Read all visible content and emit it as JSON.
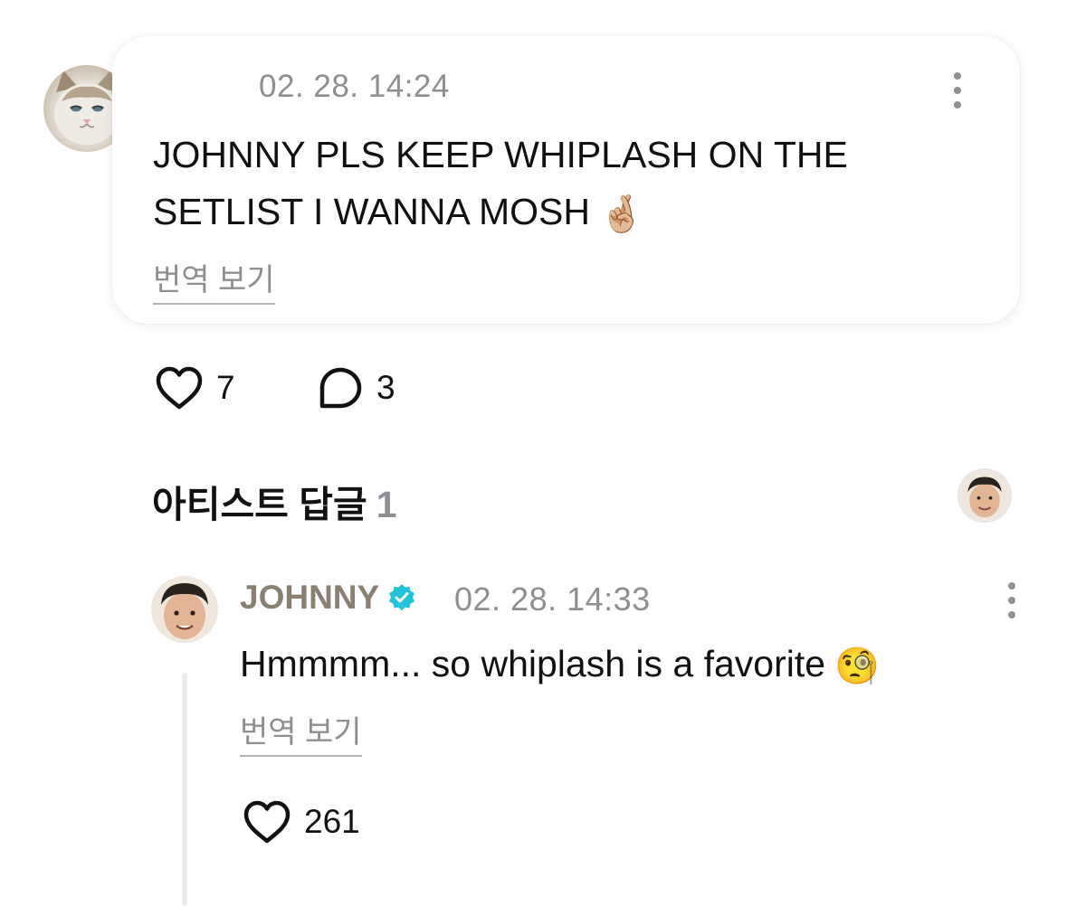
{
  "comment": {
    "timestamp": "02. 28. 14:24",
    "text": "JOHNNY PLS KEEP WHIPLASH ON THE SETLIST I WANNA MOSH",
    "emoji": "🤞🏼",
    "translate_label": "번역 보기",
    "like_count": "7",
    "reply_count": "3",
    "avatar_icon": "cat-avatar"
  },
  "artist_replies": {
    "title": "아티스트 답글",
    "count": "1"
  },
  "reply": {
    "author": "JOHNNY",
    "verified_icon": "verified-badge-icon",
    "verified_color": "#21c3d8",
    "timestamp": "02. 28. 14:33",
    "text": "Hmmmm... so whiplash is a favorite",
    "emoji": "🧐",
    "translate_label": "번역 보기",
    "like_count": "261"
  }
}
